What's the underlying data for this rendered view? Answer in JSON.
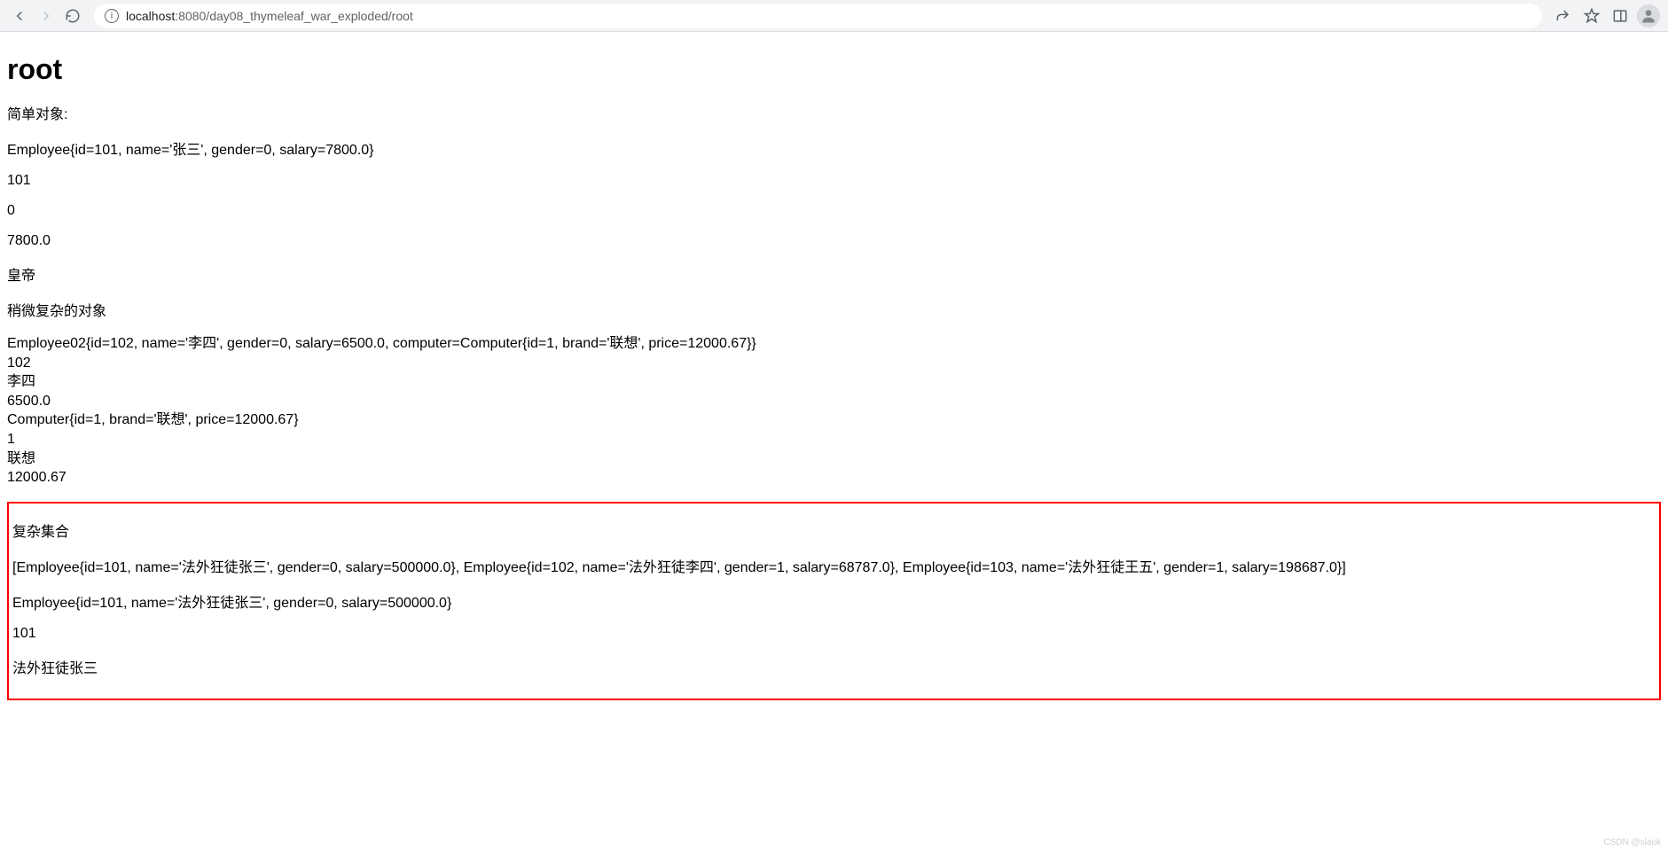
{
  "browser": {
    "url_host": "localhost",
    "url_rest": ":8080/day08_thymeleaf_war_exploded/root"
  },
  "page": {
    "title": "root",
    "simple_label": "简单对象:",
    "emp1": "Employee{id=101, name='张三', gender=0, salary=7800.0}",
    "emp1_id": "101",
    "emp1_gender": "0",
    "emp1_salary": "7800.0",
    "emperor": "皇帝",
    "complex_label": "稍微复杂的对象",
    "emp2": "Employee02{id=102, name='李四', gender=0, salary=6500.0, computer=Computer{id=1, brand='联想', price=12000.67}}",
    "emp2_id": "102",
    "emp2_name": "李四",
    "emp2_salary": "6500.0",
    "computer": "Computer{id=1, brand='联想', price=12000.67}",
    "computer_id": "1",
    "computer_brand": "联想",
    "computer_price": "12000.67",
    "collection_label": "复杂集合",
    "collection_list": "[Employee{id=101, name='法外狂徒张三', gender=0, salary=500000.0}, Employee{id=102, name='法外狂徒李四', gender=1, salary=68787.0}, Employee{id=103, name='法外狂徒王五', gender=1, salary=198687.0}]",
    "coll_emp1": "Employee{id=101, name='法外狂徒张三', gender=0, salary=500000.0}",
    "coll_emp1_id": "101",
    "coll_emp1_name": "法外狂徒张三"
  },
  "watermark": "CSDN @slaok"
}
